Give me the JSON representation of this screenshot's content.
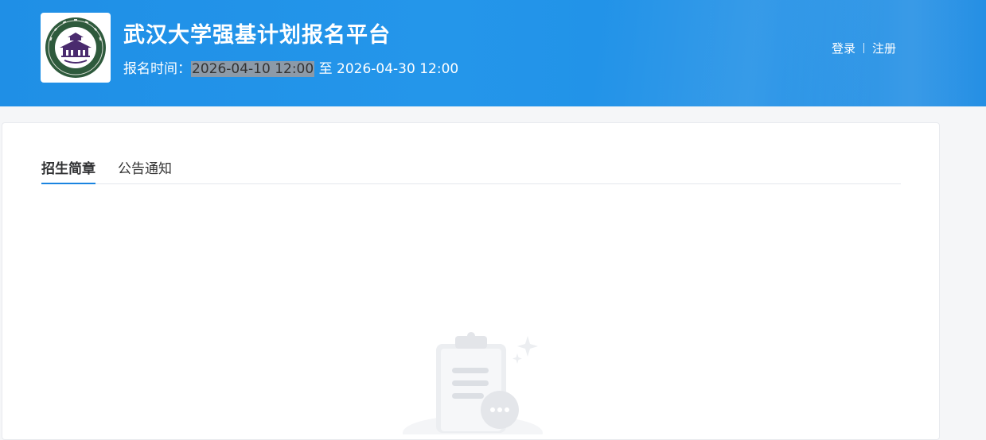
{
  "header": {
    "title": "武汉大学强基计划报名平台",
    "reg_time_label": "报名时间：",
    "reg_start": "2026-04-10 12:00",
    "reg_to": " 至 ",
    "reg_end": "2026-04-30 12:00",
    "login_label": "登录",
    "register_label": "注册",
    "logo_icon": "wuhan-university-seal"
  },
  "tabs": [
    {
      "label": "招生简章",
      "active": true
    },
    {
      "label": "公告通知",
      "active": false
    }
  ],
  "empty_state": {
    "icon": "empty-clipboard-icon"
  },
  "colors": {
    "header_blue": "#1f8fe6",
    "accent": "#1a84e0"
  }
}
